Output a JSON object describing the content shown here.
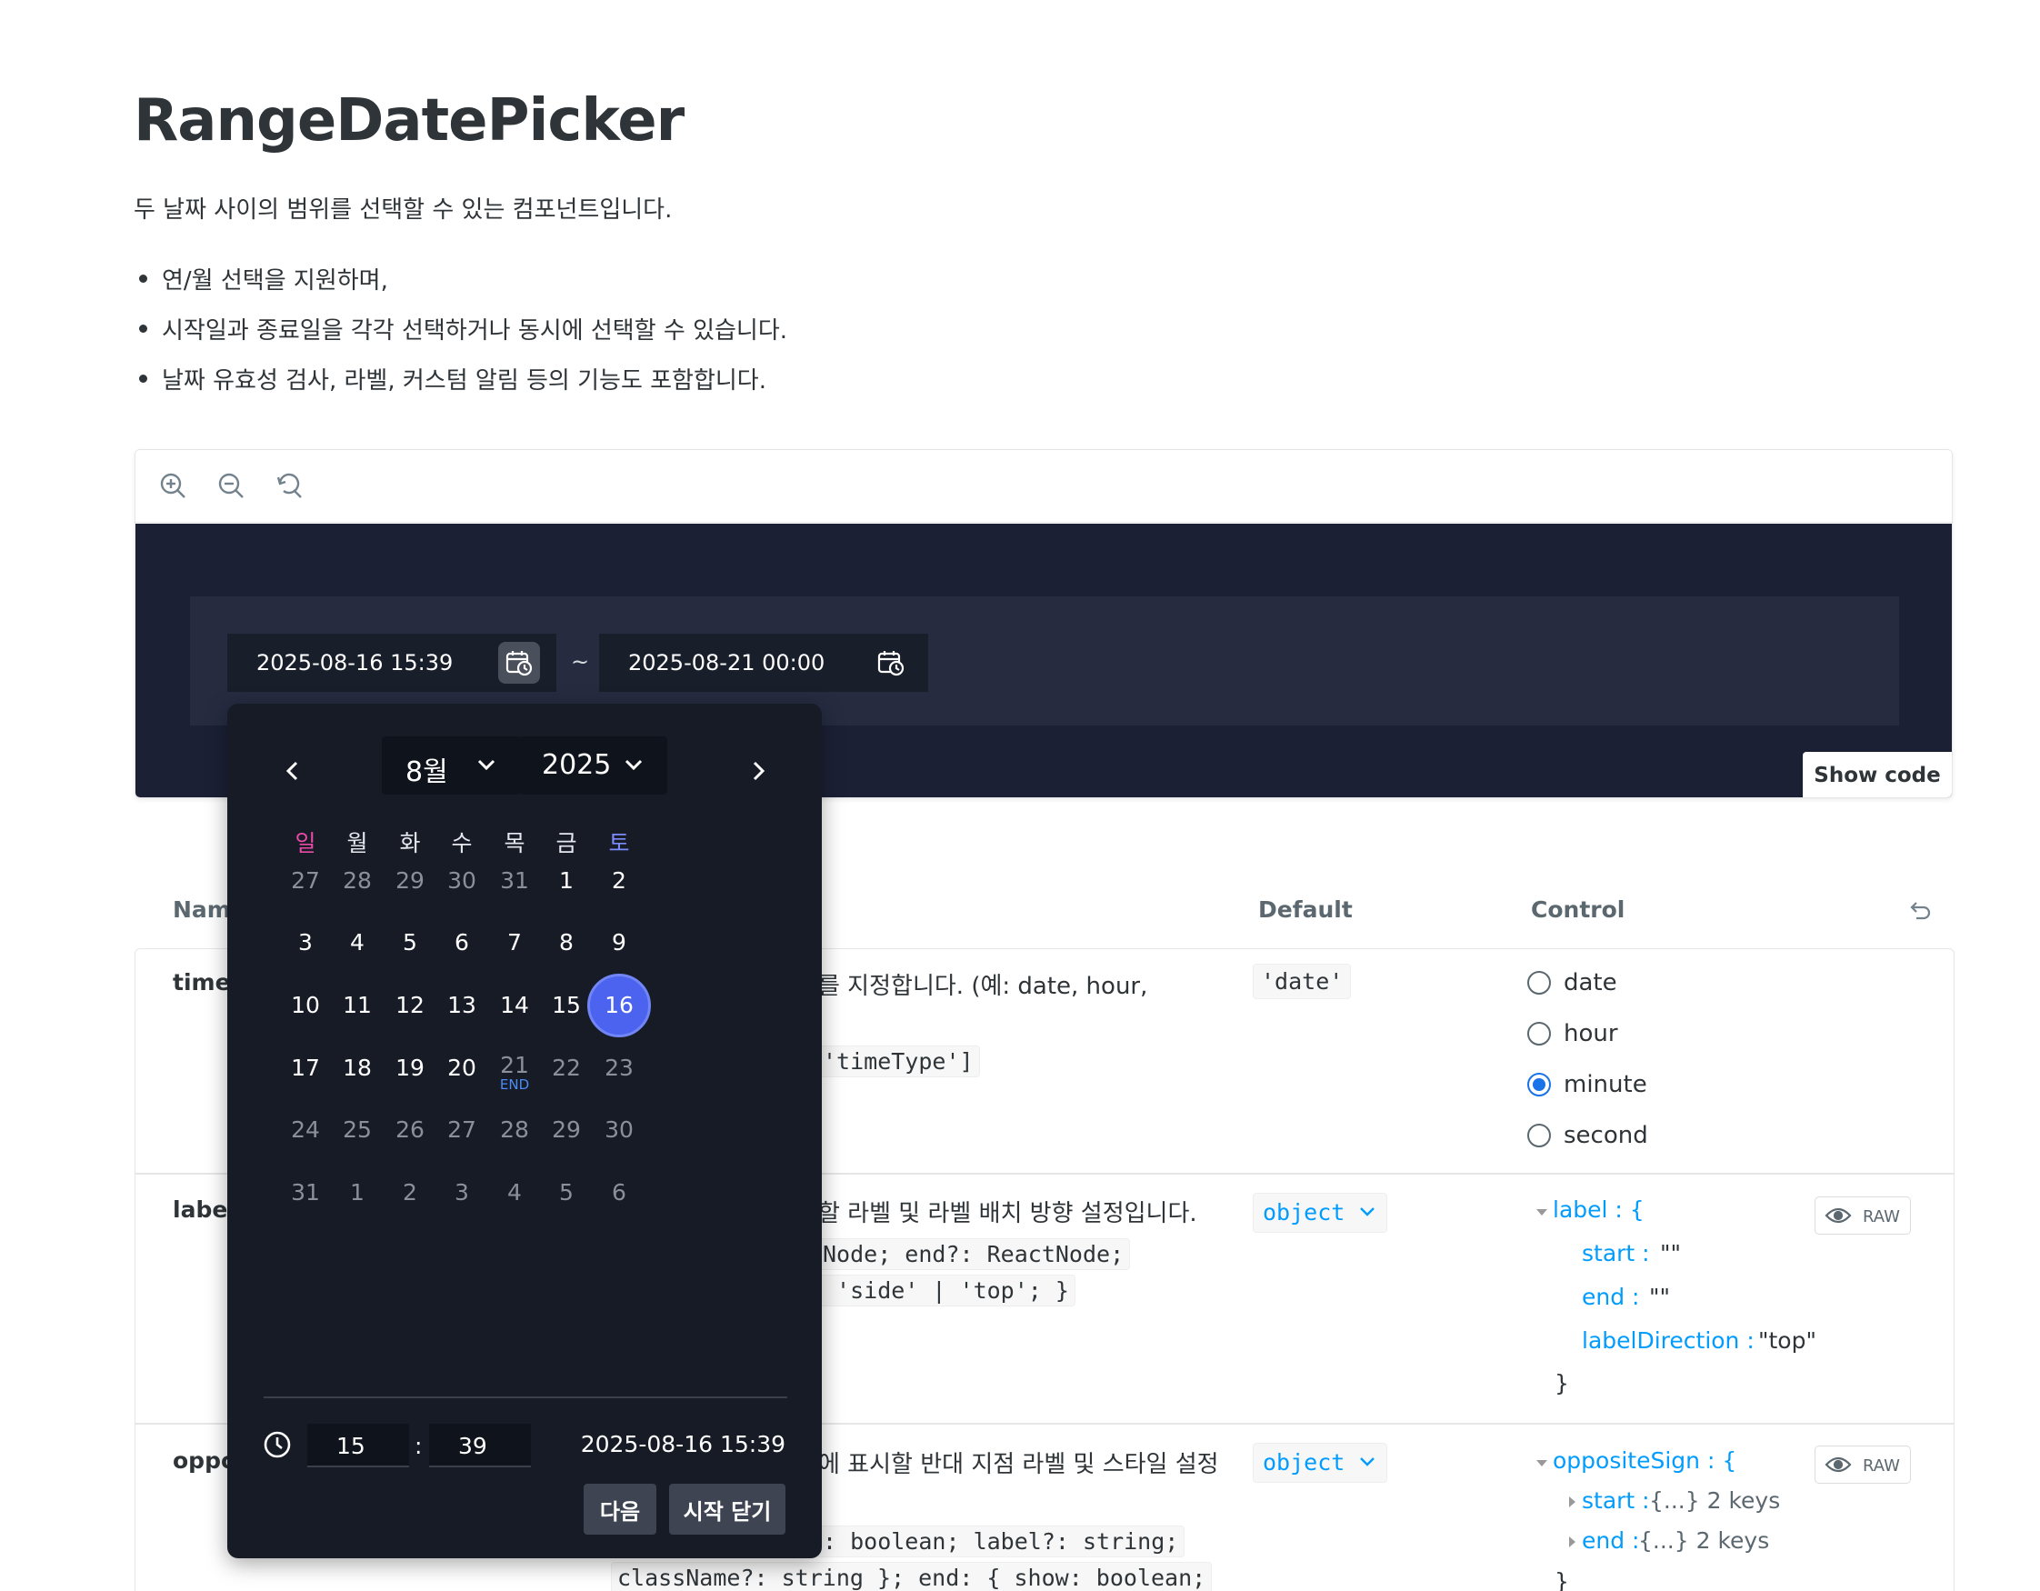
{
  "page": {
    "title": "RangeDatePicker",
    "description": "두 날짜 사이의 범위를 선택할 수 있는 컴포넌트입니다.",
    "bullets": [
      "연/월 선택을 지원하며,",
      "시작일과 종료일을 각각 선택하거나 동시에 선택할 수 있습니다.",
      "날짜 유효성 검사, 라벨, 커스텀 알림 등의 기능도 포함합니다."
    ]
  },
  "toolbar": {
    "icons": [
      "zoom-in-icon",
      "zoom-out-icon",
      "reset-zoom-icon"
    ]
  },
  "preview": {
    "start_value": "2025-08-16 15:39",
    "separator": "~",
    "end_value": "2025-08-21 00:00",
    "show_code_label": "Show code"
  },
  "calendar": {
    "month_label": "8월",
    "year_label": "2025",
    "weekdays": [
      "일",
      "월",
      "화",
      "수",
      "목",
      "금",
      "토"
    ],
    "weekday_colors": {
      "sunday": "#e84aa6",
      "saturday": "#7b8cff"
    },
    "weeks": [
      [
        {
          "d": "27",
          "m": 1
        },
        {
          "d": "28",
          "m": 1
        },
        {
          "d": "29",
          "m": 1
        },
        {
          "d": "30",
          "m": 1
        },
        {
          "d": "31",
          "m": 1
        },
        {
          "d": "1",
          "m": 0
        },
        {
          "d": "2",
          "m": 0
        }
      ],
      [
        {
          "d": "3",
          "m": 0
        },
        {
          "d": "4",
          "m": 0
        },
        {
          "d": "5",
          "m": 0
        },
        {
          "d": "6",
          "m": 0
        },
        {
          "d": "7",
          "m": 0
        },
        {
          "d": "8",
          "m": 0
        },
        {
          "d": "9",
          "m": 0
        }
      ],
      [
        {
          "d": "10",
          "m": 0
        },
        {
          "d": "11",
          "m": 0
        },
        {
          "d": "12",
          "m": 0
        },
        {
          "d": "13",
          "m": 0
        },
        {
          "d": "14",
          "m": 0
        },
        {
          "d": "15",
          "m": 0
        },
        {
          "d": "16",
          "m": 0,
          "sel": 1
        }
      ],
      [
        {
          "d": "17",
          "m": 0
        },
        {
          "d": "18",
          "m": 0
        },
        {
          "d": "19",
          "m": 0
        },
        {
          "d": "20",
          "m": 0
        },
        {
          "d": "21",
          "m": 1,
          "sub": "END"
        },
        {
          "d": "22",
          "m": 1
        },
        {
          "d": "23",
          "m": 1
        }
      ],
      [
        {
          "d": "24",
          "m": 1
        },
        {
          "d": "25",
          "m": 1
        },
        {
          "d": "26",
          "m": 1
        },
        {
          "d": "27",
          "m": 1
        },
        {
          "d": "28",
          "m": 1
        },
        {
          "d": "29",
          "m": 1
        },
        {
          "d": "30",
          "m": 1
        }
      ],
      [
        {
          "d": "31",
          "m": 1
        },
        {
          "d": "1",
          "m": 1
        },
        {
          "d": "2",
          "m": 1
        },
        {
          "d": "3",
          "m": 1
        },
        {
          "d": "4",
          "m": 1
        },
        {
          "d": "5",
          "m": 1
        },
        {
          "d": "6",
          "m": 1
        }
      ]
    ],
    "hour": "15",
    "time_separator": ":",
    "minute": "39",
    "selected_datetime": "2025-08-16 15:39",
    "next_button": "다음",
    "close_button": "시작 닫기"
  },
  "table": {
    "headers": {
      "name": "Name",
      "default": "Default",
      "control": "Control"
    },
    "rows": [
      {
        "name": "timeType",
        "desc": "를 지정합니다. (예: date, hour,",
        "code": "'timeType']",
        "default": "'date'",
        "radios": [
          "date",
          "hour",
          "minute",
          "second"
        ],
        "selected_radio": "minute"
      },
      {
        "name": "label",
        "desc": "할 라벨 및 라벨 배치 방향 설정입니다.",
        "code1": "Node; end?: ReactNode;",
        "code2": " 'side' | 'top'; }",
        "default": "object",
        "json": {
          "root_key": "label : {",
          "start_key": "start :",
          "start_val": "\"\"",
          "end_key": "end :",
          "end_val": "\"\"",
          "dir_key": "labelDirection :",
          "dir_val": "\"top\"",
          "close": "}"
        },
        "raw_label": "RAW"
      },
      {
        "name": "oppositeSign",
        "desc": "에 표시할 반대 지점 라벨 및 스타일 설정",
        "code1": ": boolean; label?: string;",
        "code2": "className?: string }; end: { show: boolean;",
        "default": "object",
        "json": {
          "root_key": "oppositeSign : {",
          "start_key": "start :",
          "start_val": "{...} 2 keys",
          "end_key": "end :",
          "end_val": "{...} 2 keys",
          "close": "}"
        },
        "raw_label": "RAW"
      }
    ]
  }
}
